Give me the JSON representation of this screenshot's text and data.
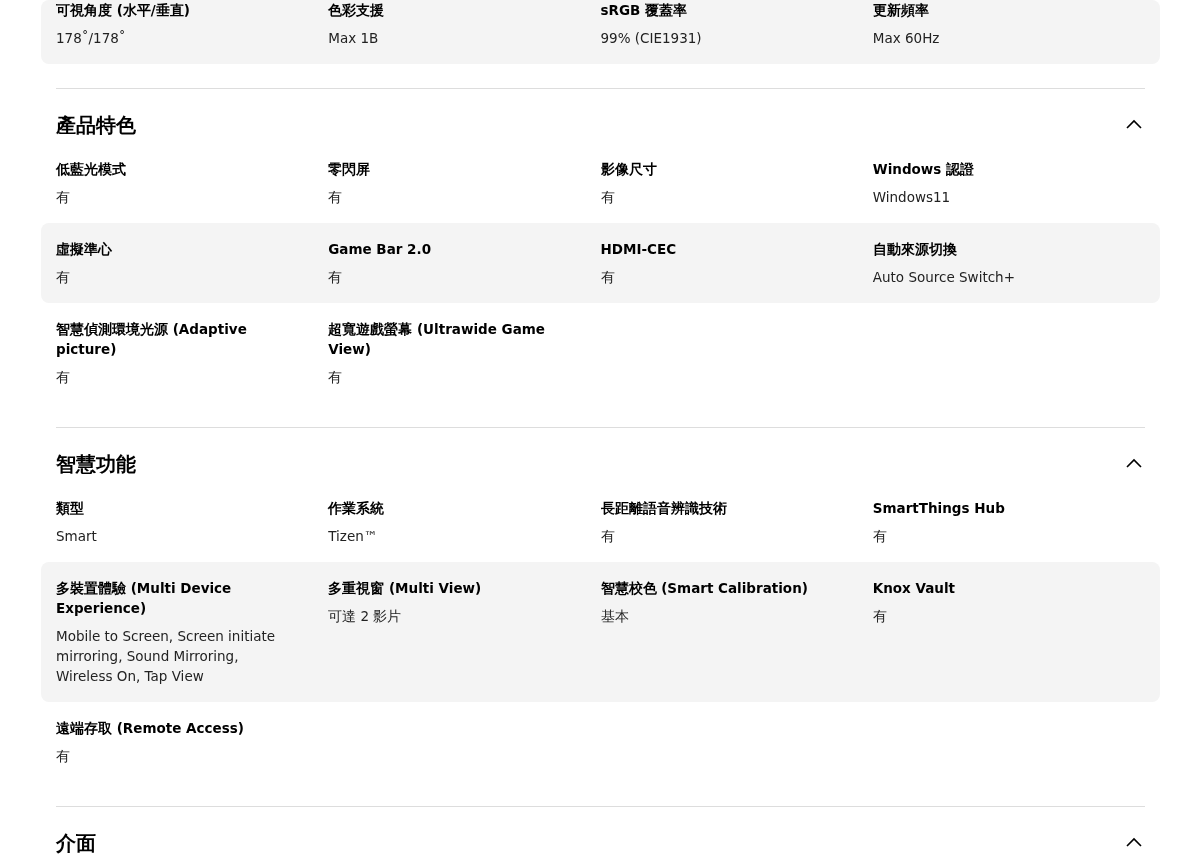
{
  "top_rows": [
    [
      {
        "label": "可視角度 (水平/垂直)",
        "value": "178˚/178˚"
      },
      {
        "label": "色彩支援",
        "value": "Max 1B"
      },
      {
        "label": "sRGB 覆蓋率",
        "value": "99% (CIE1931)"
      },
      {
        "label": "更新頻率",
        "value": "Max 60Hz"
      }
    ]
  ],
  "sections": [
    {
      "title": "產品特色",
      "expanded": true,
      "rows": [
        [
          {
            "label": "低藍光模式",
            "value": "有"
          },
          {
            "label": "零閃屏",
            "value": "有"
          },
          {
            "label": "影像尺寸",
            "value": "有"
          },
          {
            "label": "Windows 認證",
            "value": "Windows11"
          }
        ],
        [
          {
            "label": "虛擬準心",
            "value": "有"
          },
          {
            "label": "Game Bar 2.0",
            "value": "有"
          },
          {
            "label": "HDMI-CEC",
            "value": "有"
          },
          {
            "label": "自動來源切換",
            "value": "Auto Source Switch+"
          }
        ],
        [
          {
            "label": "智慧偵測環境光源 (Adaptive picture)",
            "value": "有"
          },
          {
            "label": "超寬遊戲螢幕 (Ultrawide Game View)",
            "value": "有"
          }
        ]
      ]
    },
    {
      "title": "智慧功能",
      "expanded": true,
      "rows": [
        [
          {
            "label": "類型",
            "value": "Smart"
          },
          {
            "label": "作業系統",
            "value": "Tizen™"
          },
          {
            "label": "長距離語音辨識技術",
            "value": "有"
          },
          {
            "label": "SmartThings Hub",
            "value": "有"
          }
        ],
        [
          {
            "label": "多裝置體驗 (Multi Device Experience)",
            "value": "Mobile to Screen, Screen initiate mirroring, Sound Mirroring, Wireless On, Tap View"
          },
          {
            "label": "多重視窗 (Multi View)",
            "value": "可達 2 影片"
          },
          {
            "label": "智慧校色 (Smart Calibration)",
            "value": "基本"
          },
          {
            "label": "Knox Vault",
            "value": "有"
          }
        ],
        [
          {
            "label": "遠端存取 (Remote Access)",
            "value": "有"
          }
        ]
      ]
    },
    {
      "title": "介面",
      "expanded": true
    }
  ]
}
